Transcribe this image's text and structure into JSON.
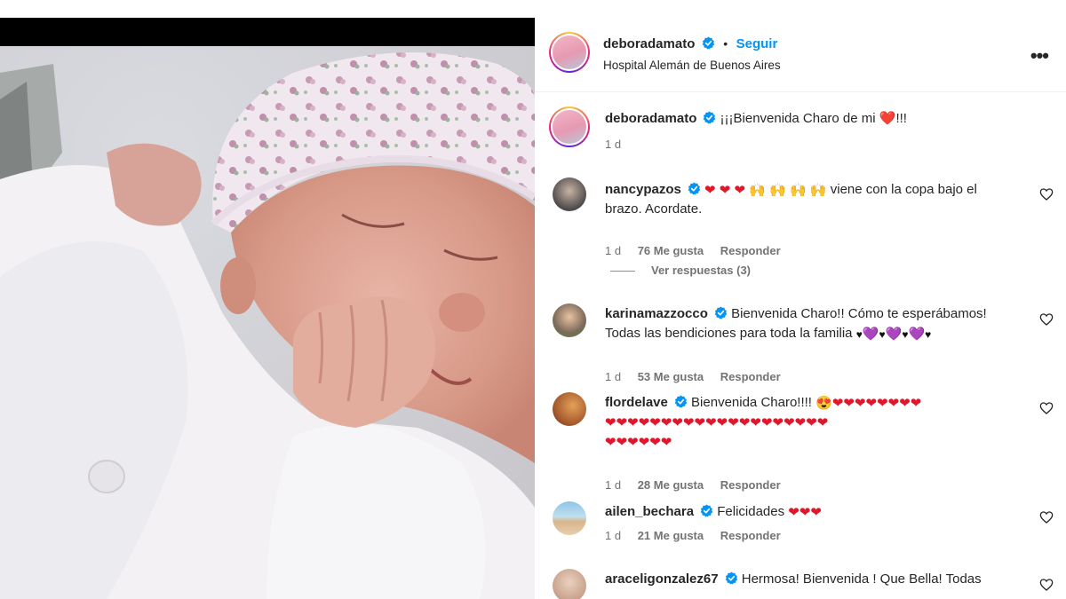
{
  "post": {
    "author": "deboradamato",
    "follow_label": "Seguir",
    "location": "Hospital Alemán de Buenos Aires",
    "more_label": "•••",
    "caption": "¡¡¡Bienvenida Charo de mi ❤️!!!",
    "caption_time": "1 d"
  },
  "replies_label": "Ver respuestas (3)",
  "comments": [
    {
      "user": "nancypazos",
      "text_line1": "viene con la copa bajo el",
      "text_line2": "brazo. Acordate.",
      "time": "1 d",
      "likes": "76 Me gusta",
      "reply": "Responder"
    },
    {
      "user": "karinamazzocco",
      "text_line1": "Bienvenida Charo!! Cómo te esperábamos!",
      "text_line2": "Todas las bendiciones para toda la familia",
      "time": "1 d",
      "likes": "53 Me gusta",
      "reply": "Responder"
    },
    {
      "user": "flordelave",
      "text_line1": "Bienvenida Charo!!!!",
      "time": "1 d",
      "likes": "28 Me gusta",
      "reply": "Responder"
    },
    {
      "user": "ailen_bechara",
      "text_line1": "Felicidades",
      "time": "1 d",
      "likes": "21 Me gusta",
      "reply": "Responder"
    },
    {
      "user": "araceligonzalez67",
      "text_line1": "Hermosa! Bienvenida ! Que Bella! Todas"
    }
  ],
  "icons": {
    "verified": "verified-badge-icon",
    "like": "heart-outline-icon",
    "more": "more-options-icon"
  },
  "colors": {
    "link_blue": "#0095f6",
    "verified_blue": "#0095f6",
    "heart_red": "#e0162b",
    "secondary_text": "#737373"
  }
}
